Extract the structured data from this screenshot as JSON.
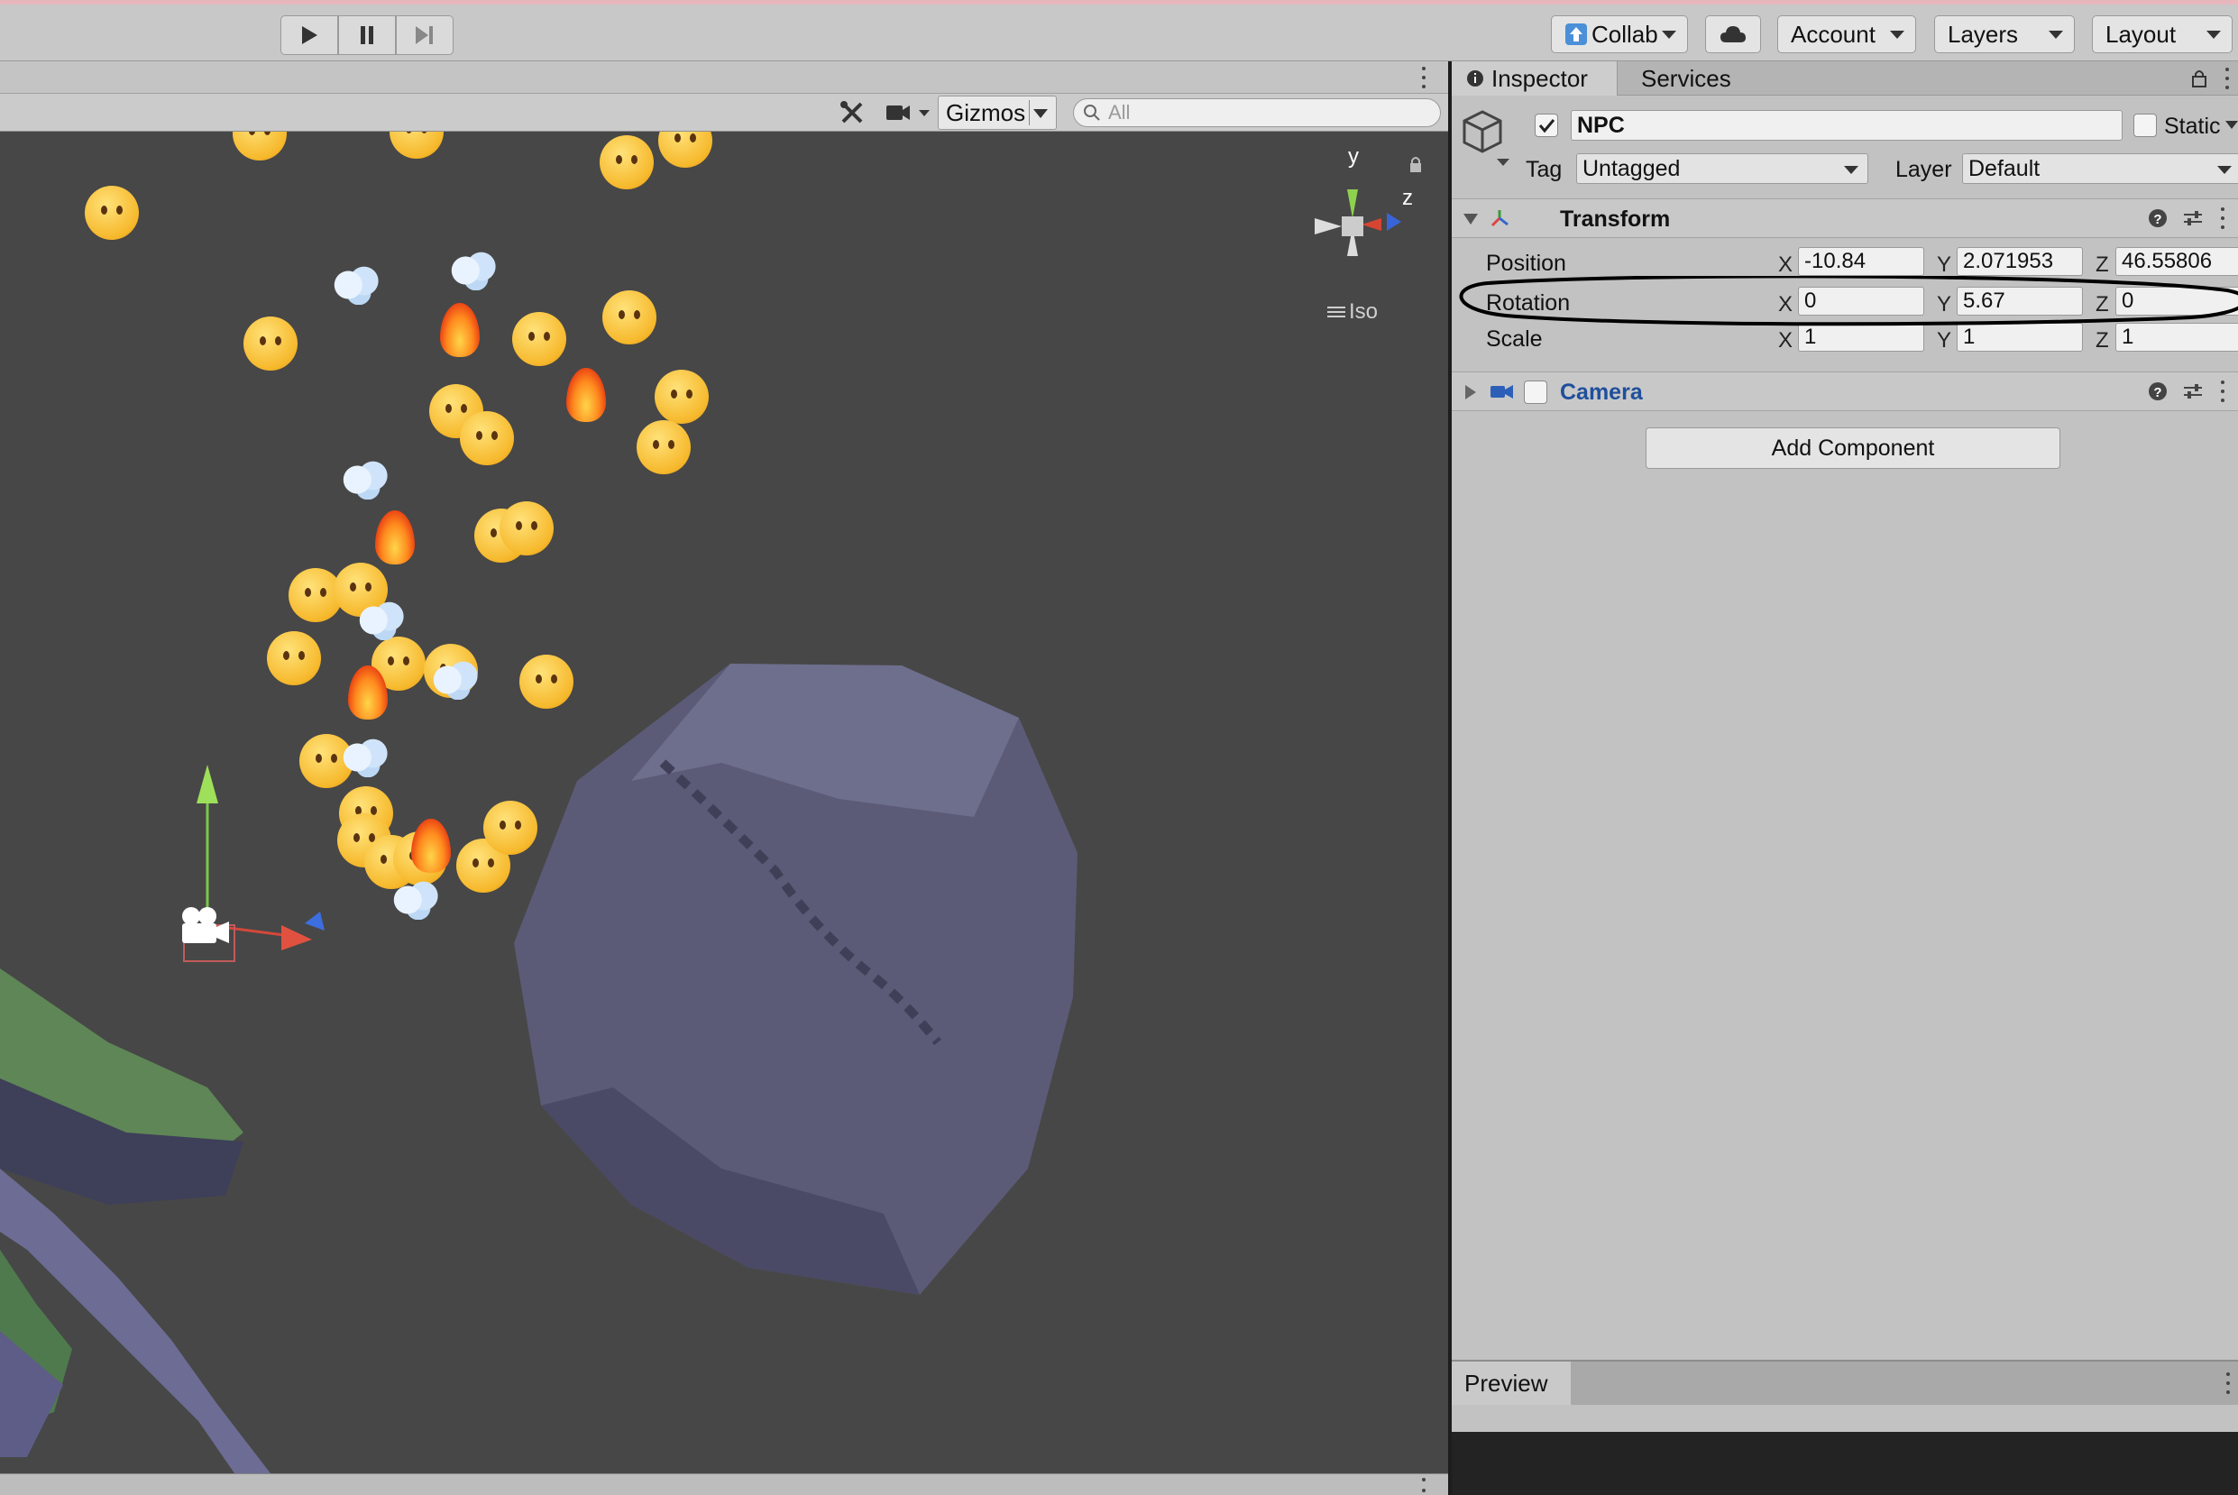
{
  "toolbar": {
    "play_icon": "play-icon",
    "pause_icon": "pause-icon",
    "step_icon": "step-icon",
    "collab_label": "Collab",
    "account_label": "Account",
    "layers_label": "Layers",
    "layout_label": "Layout"
  },
  "scene": {
    "gizmos_label": "Gizmos",
    "search_placeholder": "All",
    "iso_label": "Iso",
    "axis_y": "y",
    "axis_z": "z"
  },
  "inspector": {
    "tabs": [
      "Inspector",
      "Services"
    ],
    "object_name": "NPC",
    "static_label": "Static",
    "tag_label": "Tag",
    "tag_value": "Untagged",
    "layer_label": "Layer",
    "layer_value": "Default",
    "transform": {
      "title": "Transform",
      "position": {
        "label": "Position",
        "x": "-10.84",
        "y": "2.071953",
        "z": "46.55806"
      },
      "rotation": {
        "label": "Rotation",
        "x": "0",
        "y": "5.67",
        "z": "0"
      },
      "scale": {
        "label": "Scale",
        "x": "1",
        "y": "1",
        "z": "1"
      },
      "axis_labels": [
        "X",
        "Y",
        "Z"
      ]
    },
    "camera": {
      "title": "Camera"
    },
    "add_component_label": "Add Component",
    "preview_label": "Preview"
  },
  "colors": {
    "scene_bg": "#474747",
    "panel_bg": "#c2c2c2",
    "camera_title": "#1f4f9c",
    "rock": "#5b5b78"
  }
}
